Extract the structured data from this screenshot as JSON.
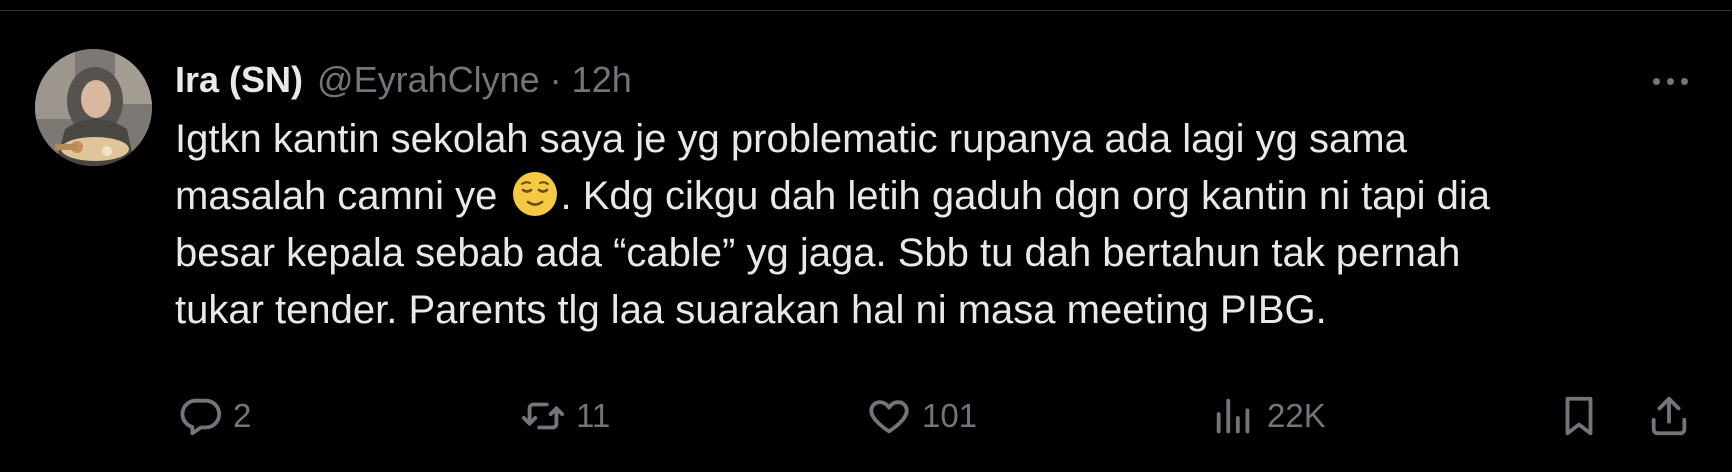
{
  "tweet": {
    "author": {
      "display_name": "Ira (SN)",
      "handle": "@EyrahClyne",
      "separator": "·",
      "time": "12h"
    },
    "text_lines": [
      "Igtkn kantin sekolah saya je yg problematic rupanya ada lagi yg sama",
      "masalah camni ye",
      ". Kdg cikgu dah letih gaduh dgn org kantin ni tapi dia",
      "besar kepala sebab ada “cable” yg jaga. Sbb tu dah bertahun tak pernah",
      "tukar tender. Parents tlg laa suarakan hal ni masa meeting PIBG."
    ],
    "emoji": "relieved-face",
    "actions": {
      "replies": "2",
      "reposts": "11",
      "likes": "101",
      "views": "22K"
    }
  },
  "icons": {
    "reply": "speech-bubble-icon",
    "repost": "repost-arrows-icon",
    "like": "heart-icon",
    "views": "bar-chart-icon",
    "bookmark": "bookmark-icon",
    "share": "share-upload-icon",
    "more": "more-horizontal-icon"
  },
  "colors": {
    "background": "#000000",
    "text": "#e7e9ea",
    "secondary": "#71767b",
    "divider": "#2f3336"
  }
}
